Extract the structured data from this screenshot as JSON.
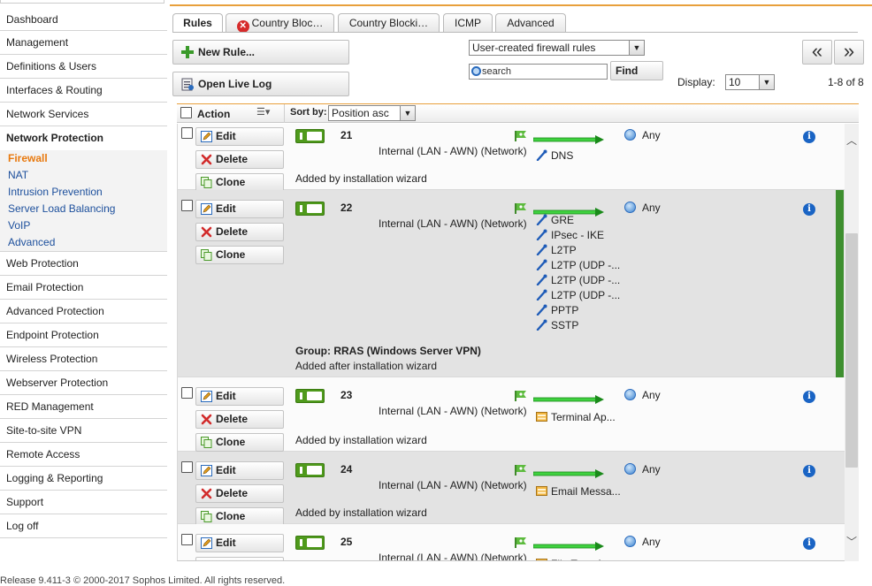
{
  "sidebar": {
    "items_top": [
      "Dashboard",
      "Management",
      "Definitions & Users",
      "Interfaces & Routing",
      "Network Services"
    ],
    "section": "Network Protection",
    "subitems": [
      "Firewall",
      "NAT",
      "Intrusion Prevention",
      "Server Load Balancing",
      "VoIP",
      "Advanced"
    ],
    "items_bottom": [
      "Web Protection",
      "Email Protection",
      "Advanced Protection",
      "Endpoint Protection",
      "Wireless Protection",
      "Webserver Protection",
      "RED Management",
      "Site-to-site VPN",
      "Remote Access",
      "Logging & Reporting",
      "Support",
      "Log off"
    ]
  },
  "tabs": [
    "Rules",
    "Country Bloc…",
    "Country Blocki…",
    "ICMP",
    "Advanced"
  ],
  "toolbar": {
    "new_rule": "New Rule...",
    "open_live_log": "Open Live Log",
    "filter_select": "User-created firewall rules",
    "search_placeholder": "search",
    "find": "Find",
    "display_label": "Display:",
    "display_value": "10",
    "range": "1-8 of 8",
    "prev": "«",
    "next": "»"
  },
  "table": {
    "action_header": "Action",
    "sort_label": "Sort by:",
    "sort_value": "Position asc",
    "edit": "Edit",
    "delete": "Delete",
    "clone": "Clone",
    "rows": [
      {
        "num": "21",
        "source": "Internal (LAN - AWN) (Network)",
        "destination": "Any",
        "services": [
          "DNS"
        ],
        "group": "",
        "comment": "Added by installation wizard"
      },
      {
        "num": "22",
        "source": "Internal (LAN - AWN) (Network)",
        "destination": "Any",
        "services": [
          "GRE",
          "IPsec - IKE",
          "L2TP",
          "L2TP (UDP -...",
          "L2TP (UDP -...",
          "L2TP (UDP -...",
          "PPTP",
          "SSTP"
        ],
        "group": "Group: RRAS (Windows Server VPN)",
        "comment": "Added after installation wizard"
      },
      {
        "num": "23",
        "source": "Internal (LAN - AWN) (Network)",
        "destination": "Any",
        "services": [
          "Terminal Ap..."
        ],
        "group": "",
        "comment": "Added by installation wizard"
      },
      {
        "num": "24",
        "source": "Internal (LAN - AWN) (Network)",
        "destination": "Any",
        "services": [
          "Email Messa..."
        ],
        "group": "",
        "comment": "Added by installation wizard"
      },
      {
        "num": "25",
        "source": "Internal (LAN - AWN) (Network)",
        "destination": "Any",
        "services": [
          "File Transfer..."
        ],
        "group": "",
        "comment": ""
      }
    ]
  },
  "footer": "Release 9.411-3 © 2000-2017 Sophos Limited. All rights reserved.",
  "colors": {
    "accent": "#e8a03c",
    "active_nav": "#e8790e",
    "link": "#1c4f9c",
    "toggle_on": "#4f9a1c",
    "selected_row": "#e3e3e3"
  }
}
